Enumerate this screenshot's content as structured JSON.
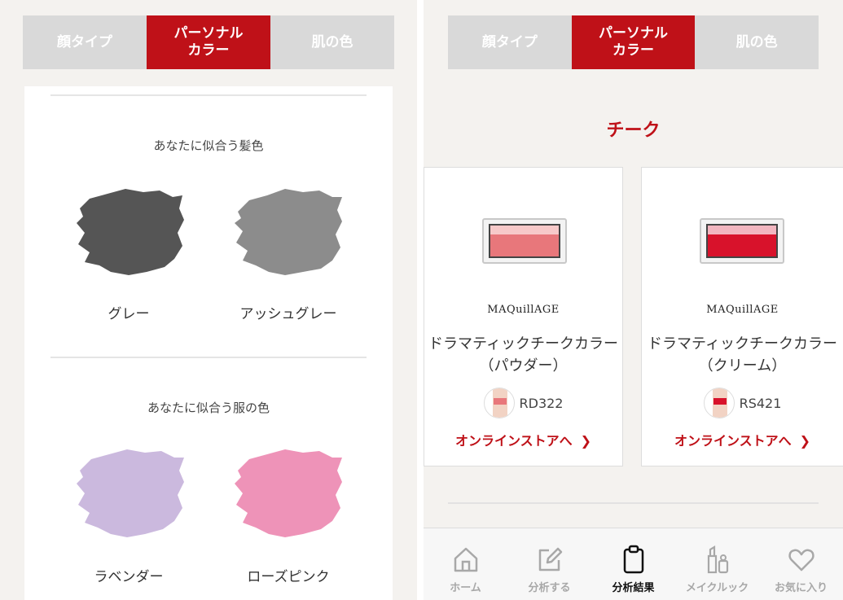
{
  "left": {
    "tabs": [
      {
        "label": "顔タイプ",
        "active": false
      },
      {
        "label": "パーソナル\nカラー",
        "active": true
      },
      {
        "label": "肌の色",
        "active": false
      }
    ],
    "hair": {
      "title": "あなたに似合う髪色",
      "colors": [
        {
          "label": "グレー",
          "color": "#555555"
        },
        {
          "label": "アッシュグレー",
          "color": "#8c8c8c"
        }
      ]
    },
    "clothes": {
      "title": "あなたに似合う服の色",
      "colors": [
        {
          "label": "ラベンダー",
          "color": "#cbb9de"
        },
        {
          "label": "ローズピンク",
          "color": "#ee93b8"
        }
      ]
    }
  },
  "right": {
    "tabs": [
      {
        "label": "顔タイプ",
        "active": false
      },
      {
        "label": "パーソナル\nカラー",
        "active": true
      },
      {
        "label": "肌の色",
        "active": false
      }
    ],
    "category_title": "チーク",
    "products": [
      {
        "brand": "MAQuillAGE",
        "name": "ドラマティックチークカラー　（パウダー）",
        "shade": "RD322",
        "link_label": "オンラインストアへ",
        "top_color": "#f7c9c9",
        "bottom_color": "#e8777b"
      },
      {
        "brand": "MAQuillAGE",
        "name": "ドラマティックチークカラー　（クリーム）",
        "shade": "RS421",
        "link_label": "オンラインストアへ",
        "top_color": "#f2b6c0",
        "bottom_color": "#d8122b"
      }
    ],
    "nav": [
      {
        "label": "ホーム",
        "icon": "home-icon",
        "active": false
      },
      {
        "label": "分析する",
        "icon": "edit-icon",
        "active": false
      },
      {
        "label": "分析結果",
        "icon": "clipboard-icon",
        "active": true
      },
      {
        "label": "メイクルック",
        "icon": "makeup-icon",
        "active": false
      },
      {
        "label": "お気に入り",
        "icon": "heart-icon",
        "active": false
      }
    ]
  }
}
